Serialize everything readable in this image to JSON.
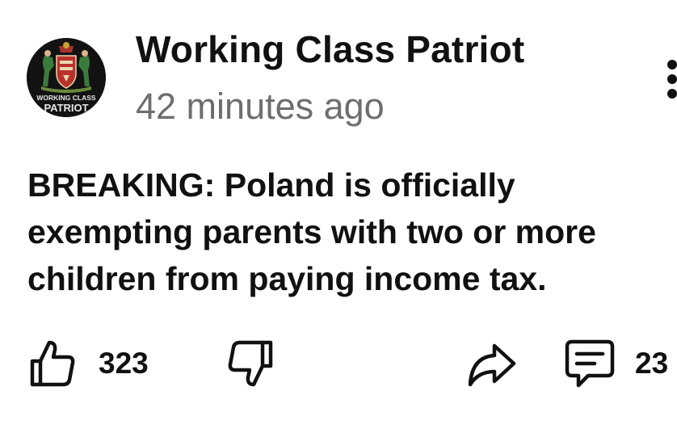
{
  "post": {
    "author": "Working Class Patriot",
    "timestamp": "42 minutes ago",
    "avatar_icon": "working-class-patriot-logo",
    "avatar_text_line1": "WORKING CLASS",
    "avatar_text_line2": "PATRIOT",
    "more_icon": "vertical-ellipsis-icon",
    "body_lines": [
      "BREAKING: Poland is officially",
      "exempting parents with two or more",
      "children from paying income tax."
    ]
  },
  "actions": {
    "like_icon": "thumbs-up-icon",
    "like_count": "323",
    "dislike_icon": "thumbs-down-icon",
    "share_icon": "share-arrow-icon",
    "comment_icon": "comment-icon",
    "comment_count": "23"
  }
}
